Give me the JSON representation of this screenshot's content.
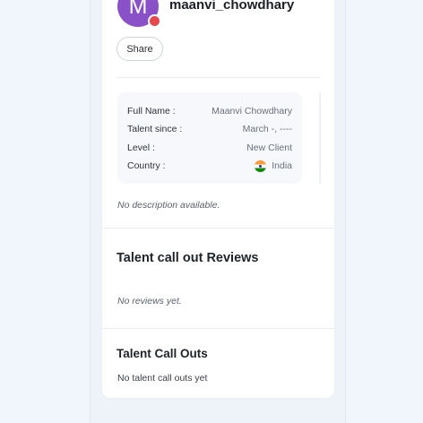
{
  "profile": {
    "avatar_letter": "M",
    "username": "maanvi_chowdhary",
    "share_label": "Share",
    "status_color": "#e5484d",
    "avatar_color": "#8a50c8"
  },
  "details": {
    "full_name_label": "Full Name :",
    "full_name_value": "Maanvi Chowdhary",
    "talent_since_label": "Talent since :",
    "talent_since_value": "March -, ----",
    "level_label": "Level :",
    "level_value": "New Client",
    "country_label": "Country :",
    "country_value": "India",
    "country_flag_icon": "india-flag-icon"
  },
  "description": {
    "text": "No description available."
  },
  "reviews": {
    "title": "Talent call out Reviews",
    "empty_text": "No reviews yet."
  },
  "callouts": {
    "title": "Talent Call Outs",
    "empty_text": "No talent call outs yet"
  }
}
